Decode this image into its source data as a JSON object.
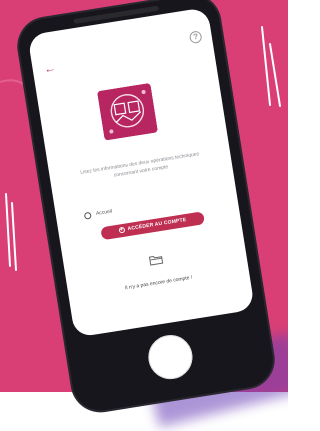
{
  "colors": {
    "background": "#d93f74",
    "accent": "#bf2f52",
    "phone_body": "#17161c",
    "shadow": "#6a3fb6"
  },
  "screen": {
    "intro_text": "Lisez les informations des deux opérations techniques\nconcernant votre compte",
    "account_label": "Accueil",
    "cta_label": "ACCÉDER AU COMPTE",
    "bottom_text": "Il n'y a pas encore de compte !"
  },
  "icons": {
    "back": "back-arrow-icon",
    "help": "help-icon",
    "user": "user-icon",
    "plus": "plus-circle-icon",
    "folder": "folder-icon",
    "logo": "app-logo"
  }
}
